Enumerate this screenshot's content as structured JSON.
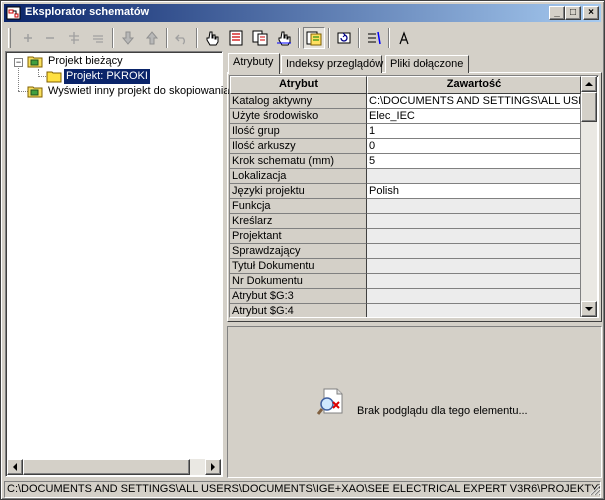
{
  "window": {
    "title": "Eksplorator schematów",
    "icon": "app-schema-icon",
    "controls": {
      "minimize": "_",
      "maximize": "□",
      "close": "×"
    }
  },
  "toolbar": {
    "buttons": [
      {
        "name": "add-icon",
        "enabled": false
      },
      {
        "name": "remove-icon",
        "enabled": false
      },
      {
        "name": "insert-sheet-icon",
        "enabled": false
      },
      {
        "name": "align-icon",
        "enabled": false
      },
      {
        "name": "move-down-icon",
        "enabled": false
      },
      {
        "name": "move-up-icon",
        "enabled": false
      },
      {
        "name": "undo-icon",
        "enabled": false
      },
      {
        "name": "hand-pointer-icon",
        "enabled": true
      },
      {
        "name": "document-list-icon",
        "enabled": true
      },
      {
        "name": "copy-pages-icon",
        "enabled": true
      },
      {
        "name": "hand-pointer-2-icon",
        "enabled": true
      },
      {
        "name": "project-view-icon",
        "enabled": true,
        "active": true
      },
      {
        "name": "refresh-icon",
        "enabled": true
      },
      {
        "name": "properties-icon",
        "enabled": true
      },
      {
        "name": "text-icon",
        "enabled": true
      }
    ]
  },
  "tree": {
    "nodes": [
      {
        "label": "Projekt bieżący",
        "expander": "−",
        "icon": "folder-project-icon",
        "level": 0
      },
      {
        "label": "Projekt: PKROKI",
        "icon": "folder-icon",
        "level": 1,
        "selected": true
      },
      {
        "label": "Wyświetl inny projekt do skopiowania",
        "icon": "folder-project-icon",
        "level": 0
      }
    ]
  },
  "tabs": [
    {
      "label": "Atrybuty",
      "active": true
    },
    {
      "label": "Indeksy przeglądów",
      "active": false
    },
    {
      "label": "Pliki dołączone",
      "active": false
    }
  ],
  "grid": {
    "headers": [
      "Atrybut",
      "Zawartość"
    ],
    "rows": [
      {
        "attr": "Katalog aktywny",
        "value": "C:\\DOCUMENTS AND SETTINGS\\ALL USERS"
      },
      {
        "attr": "Użyte środowisko",
        "value": "Elec_IEC"
      },
      {
        "attr": "Ilość grup",
        "value": "1"
      },
      {
        "attr": "Ilość arkuszy",
        "value": "0"
      },
      {
        "attr": "Krok schematu (mm)",
        "value": "5"
      },
      {
        "attr": "Lokalizacja",
        "value": ""
      },
      {
        "attr": "Języki projektu",
        "value": "Polish"
      },
      {
        "attr": "Funkcja",
        "value": ""
      },
      {
        "attr": "Kreślarz",
        "value": ""
      },
      {
        "attr": "Projektant",
        "value": ""
      },
      {
        "attr": "Sprawdzający",
        "value": ""
      },
      {
        "attr": "Tytuł Dokumentu",
        "value": ""
      },
      {
        "attr": "Nr Dokumentu",
        "value": ""
      },
      {
        "attr": "Atrybut $G:3",
        "value": ""
      },
      {
        "attr": "Atrybut $G:4",
        "value": ""
      }
    ]
  },
  "preview": {
    "icon": "no-preview-magnifier-icon",
    "message": "Brak podglądu dla tego elementu..."
  },
  "status": {
    "path": "C:\\DOCUMENTS AND SETTINGS\\ALL USERS\\DOCUMENTS\\IGE+XAO\\SEE ELECTRICAL EXPERT V3R6\\PROJEKTY\\PKROKI\\"
  },
  "colors": {
    "face": "#d4d0c8",
    "title_active": "#0a246a",
    "selection": "#0a246a"
  }
}
